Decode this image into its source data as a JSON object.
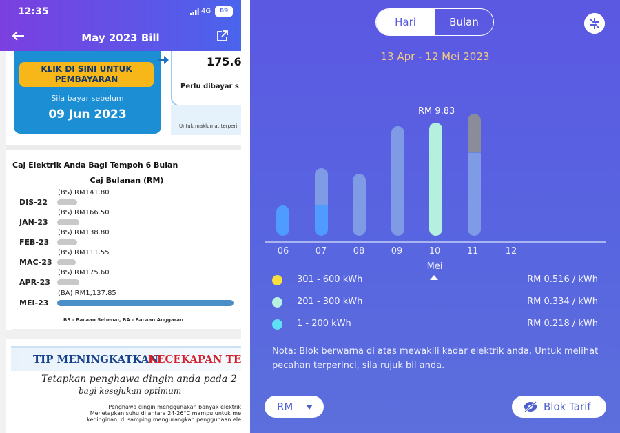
{
  "status": {
    "time": "12:35",
    "network": "4G",
    "battery": "69"
  },
  "bill_header": {
    "title": "May 2023 Bill"
  },
  "payment": {
    "button_line1": "KLIK DI SINI UNTUK",
    "button_line2": "PEMBAYARAN",
    "due_note": "Sila bayar sebelum",
    "due_date": "09 Jun 2023",
    "amount": "175.60",
    "amount_label": "Perlu dibayar s",
    "info_text": "Untuk maklumat terperi"
  },
  "charges": {
    "section_title": "Caj Elektrik Anda Bagi Tempoh 6 Bulan",
    "table_title": "Caj Bulanan (RM)",
    "rows": [
      {
        "month": "DIS-22",
        "value": "(BS) RM141.80",
        "amount": 141.8
      },
      {
        "month": "JAN-23",
        "value": "(BS) RM166.50",
        "amount": 166.5
      },
      {
        "month": "FEB-23",
        "value": "(BS) RM138.80",
        "amount": 138.8
      },
      {
        "month": "MAC-23",
        "value": "(BS) RM111.55",
        "amount": 111.55
      },
      {
        "month": "APR-23",
        "value": "(BS) RM175.60",
        "amount": 175.6
      },
      {
        "month": "MEI-23",
        "value": "(BA) RM1,137.85",
        "amount": 1137.85
      }
    ],
    "legend": "BS - Bacaan Sebenar, BA - Bacaan Anggaran"
  },
  "tip": {
    "title_part1": "TIP MENINGKATKAN",
    "title_part2": "KECEKAPAN TE",
    "script_line1": "Tetapkan penghawa dingin anda pada 2",
    "script_line2": "bagi kesejukan optimum",
    "body_line1": "Penghawa dingin menggunakan banyak elektrik",
    "body_line2": "Menetapkan suhu di antara 24-26°C mampu untuk me",
    "body_line3": "kedinginan, di samping mengurangkan penggunaan ele"
  },
  "usage": {
    "toggle": {
      "day_label": "Hari",
      "month_label": "Bulan",
      "active": "Hari"
    },
    "period": "13 Apr - 12 Mei 2023",
    "peak_label": "RM 9.83",
    "month_label": "Mei",
    "colors": {
      "low": "#4f9bff",
      "mid": "#b5f0de",
      "high": "#8a8d99",
      "faded": "#7f9be6"
    },
    "tiers": [
      {
        "range": "301 - 600 kWh",
        "price": "RM 0.516 / kWh",
        "color": "#f7df3e"
      },
      {
        "range": "201 - 300 kWh",
        "price": "RM 0.334 / kWh",
        "color": "#b8f3e2"
      },
      {
        "range": "1 - 200 kWh",
        "price": "RM 0.218 / kWh",
        "color": "#5fe0f6"
      }
    ],
    "note": "Nota: Blok berwarna di atas mewakili kadar elektrik anda. Untuk melihat pecahan terperinci, sila rujuk bil anda.",
    "unit_label": "RM",
    "tariff_label": "Blok Tarif"
  },
  "chart_data": {
    "type": "bar",
    "categories": [
      "06",
      "07",
      "08",
      "09",
      "10",
      "11",
      "12"
    ],
    "series": [
      {
        "values": [
          0.27,
          0.27,
          0.55,
          0.97,
          1.0,
          0.73,
          0
        ]
      },
      {
        "values": [
          0,
          0.33,
          0.0,
          0.0,
          0.0,
          0.35,
          0
        ]
      }
    ],
    "selected_category": "10",
    "selected_value_label": "RM 9.83"
  }
}
